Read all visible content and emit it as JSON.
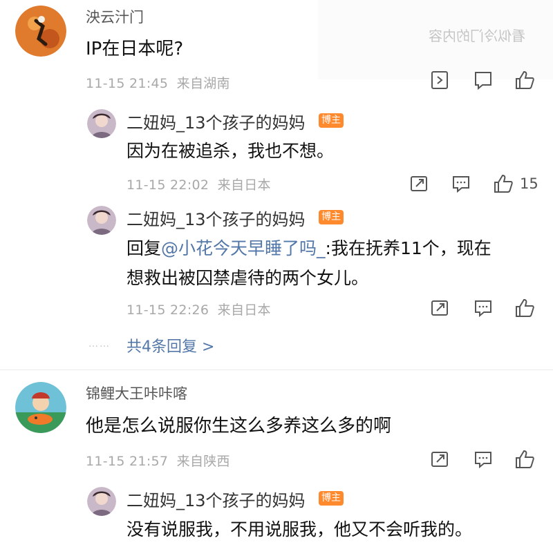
{
  "watermark": "看似冷门的内容",
  "comments": [
    {
      "user": "泱云汁门",
      "text": "IP在日本呢?",
      "time": "11-15 21:45",
      "location": "来自湖南",
      "replies": [
        {
          "user": "二妞妈_13个孩子的妈妈",
          "badge": "博主",
          "text": "因为在被追杀，我也不想。",
          "time": "11-15 22:02",
          "location": "来自日本",
          "likes": "15"
        },
        {
          "user": "二妞妈_13个孩子的妈妈",
          "badge": "博主",
          "reply_prefix": "回复",
          "mention": "@小花今天早睡了吗_",
          "text_line1": ":我在抚养11个，现在",
          "text_line2": "想救出被囚禁虐待的两个女儿。",
          "time": "11-15 22:26",
          "location": "来自日本"
        }
      ],
      "more_replies": "共4条回复 >"
    },
    {
      "user": "锦鲤大王咔咔喀",
      "text": "他是怎么说服你生这么多养这么多的啊",
      "time": "11-15 21:57",
      "location": "来自陕西",
      "replies": [
        {
          "user": "二妞妈_13个孩子的妈妈",
          "badge": "博主",
          "text": "没有说服我，不用说服我，他又不会听我的。"
        }
      ]
    }
  ],
  "icons": {
    "share": "share-icon",
    "comment": "comment-icon",
    "like": "like-icon"
  },
  "colors": {
    "badge": "#ff8a2e",
    "link": "#5277a8"
  }
}
